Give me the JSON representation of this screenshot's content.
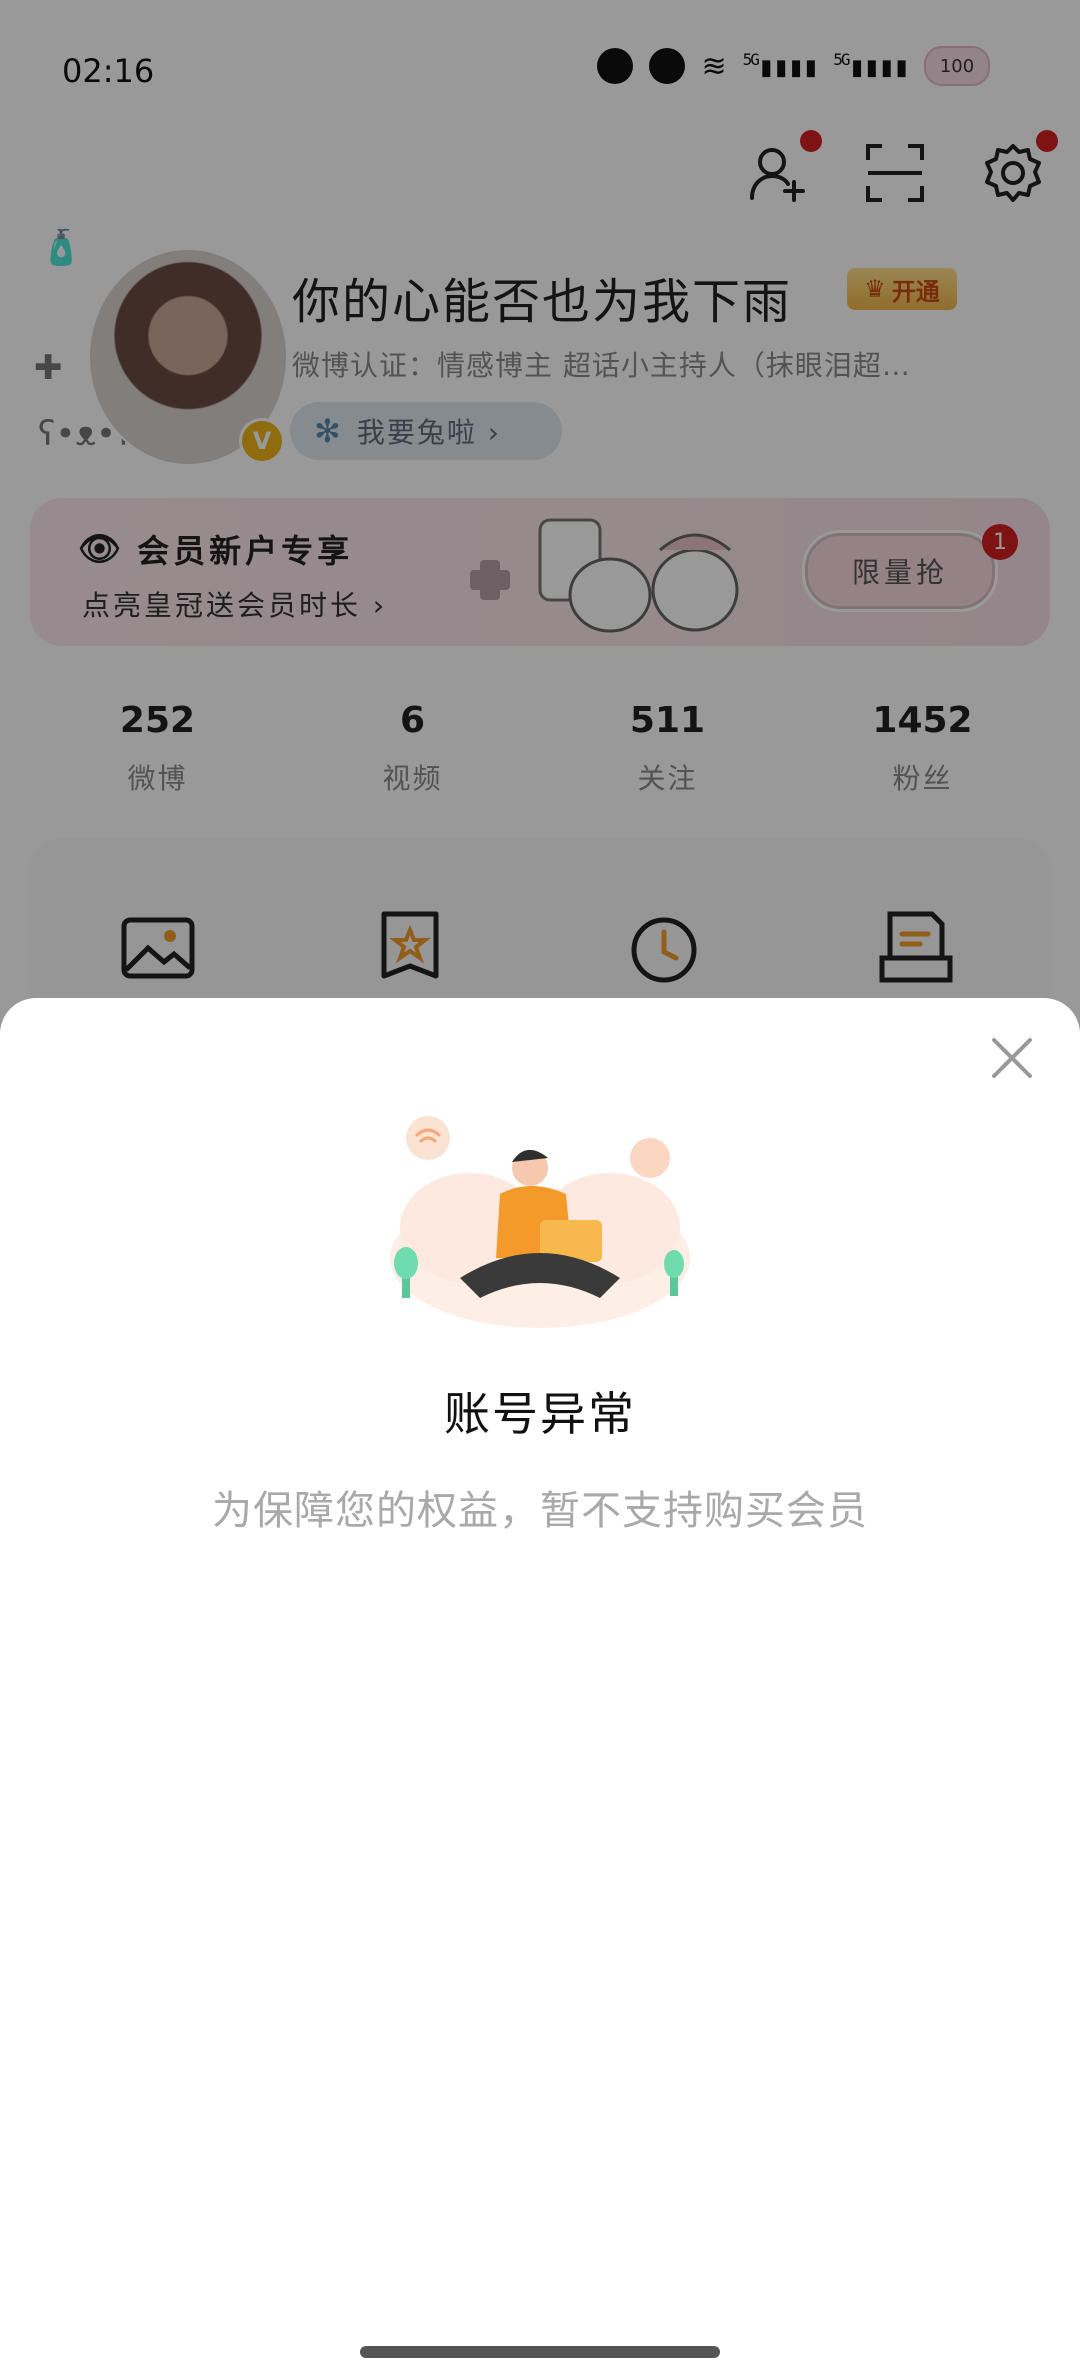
{
  "status_bar": {
    "time": "02:16",
    "signal_1": "5G",
    "signal_2": "5G",
    "battery": "100"
  },
  "profile": {
    "name": "你的心能否也为我下雨",
    "vip_label": "开通",
    "certification": "微博认证：情感博主 超话小主持人（抹眼泪超…",
    "tag_label": "我要兔啦 ›"
  },
  "member_banner": {
    "title": "会员新户专享",
    "subtitle": "点亮皇冠送会员时长 ›",
    "button_label": "限量抢",
    "badge": "1"
  },
  "stats": [
    {
      "num": "252",
      "label": "微博"
    },
    {
      "num": "6",
      "label": "视频"
    },
    {
      "num": "511",
      "label": "关注"
    },
    {
      "num": "1452",
      "label": "粉丝"
    }
  ],
  "shortcut_icons": [
    "image-icon",
    "favorite-icon",
    "history-icon",
    "draft-icon"
  ],
  "dialog": {
    "title": "账号异常",
    "description": "为保障您的权益，暂不支持购买会员"
  },
  "colors": {
    "accent_orange": "#f39a2b",
    "badge_red": "#d42020",
    "vip_gold": "#f2b74b",
    "member_pink": "#fbe7ec"
  }
}
